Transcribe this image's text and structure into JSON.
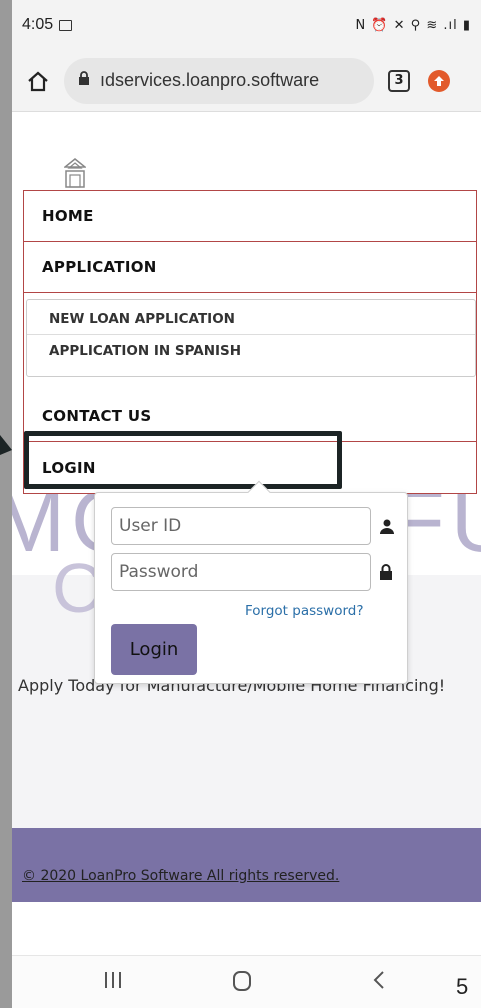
{
  "status_bar": {
    "time": "4:05",
    "right_icons": "N  ⏰  ✕  ⚲  ≋  .ıl  ▮"
  },
  "browser": {
    "url": "ıdservices.loanpro.software",
    "tab_count": "3"
  },
  "background": {
    "brand_line1": "MOBILE FUN",
    "brand_line2": "C   C",
    "tagline": "Apply Today for Manufacture/Mobile Home Financing!"
  },
  "nav": {
    "items": [
      {
        "label": "HOME"
      },
      {
        "label": "APPLICATION"
      },
      {
        "label": "CONTACT US"
      },
      {
        "label": "LOGIN"
      }
    ],
    "submenu": [
      {
        "label": "NEW LOAN APPLICATION"
      },
      {
        "label": "APPLICATION IN SPANISH"
      }
    ]
  },
  "login_form": {
    "userid_placeholder": "User ID",
    "password_placeholder": "Password",
    "forgot_label": "Forgot password?",
    "login_label": "Login"
  },
  "footer": {
    "copyright": "© 2020 LoanPro Software All rights reserved."
  },
  "page_number": "5",
  "colors": {
    "accent": "#7a72a5",
    "menu_border": "#b24646",
    "link": "#2b6fa8",
    "update_badge": "#e25a2b"
  }
}
